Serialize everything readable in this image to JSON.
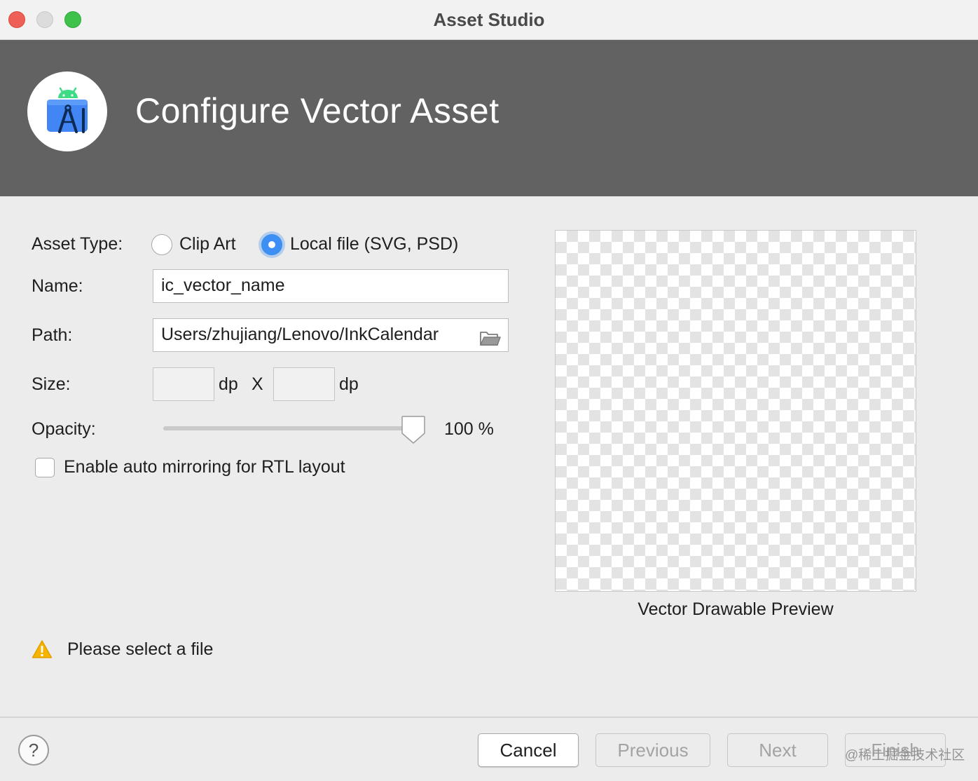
{
  "window": {
    "title": "Asset Studio"
  },
  "header": {
    "title": "Configure Vector Asset",
    "logo_icon": "android-studio-icon"
  },
  "form": {
    "asset_type": {
      "label": "Asset Type:",
      "options": [
        {
          "label": "Clip Art",
          "selected": false
        },
        {
          "label": "Local file (SVG, PSD)",
          "selected": true
        }
      ]
    },
    "name": {
      "label": "Name:",
      "value": "ic_vector_name"
    },
    "path": {
      "label": "Path:",
      "value": "Users/zhujiang/Lenovo/InkCalendar",
      "browse_icon": "folder-open-icon"
    },
    "size": {
      "label": "Size:",
      "width_value": "",
      "height_value": "",
      "unit": "dp",
      "separator": "X"
    },
    "opacity": {
      "label": "Opacity:",
      "value": 100,
      "display": "100 %"
    },
    "auto_mirror": {
      "label": "Enable auto mirroring for RTL layout",
      "checked": false
    }
  },
  "preview": {
    "label": "Vector Drawable Preview"
  },
  "status": {
    "icon": "warning-icon",
    "message": "Please select a file"
  },
  "footer": {
    "help_label": "?",
    "buttons": {
      "cancel": "Cancel",
      "previous": "Previous",
      "next": "Next",
      "finish": "Finish"
    }
  },
  "watermark": "@稀土掘金技术社区"
}
